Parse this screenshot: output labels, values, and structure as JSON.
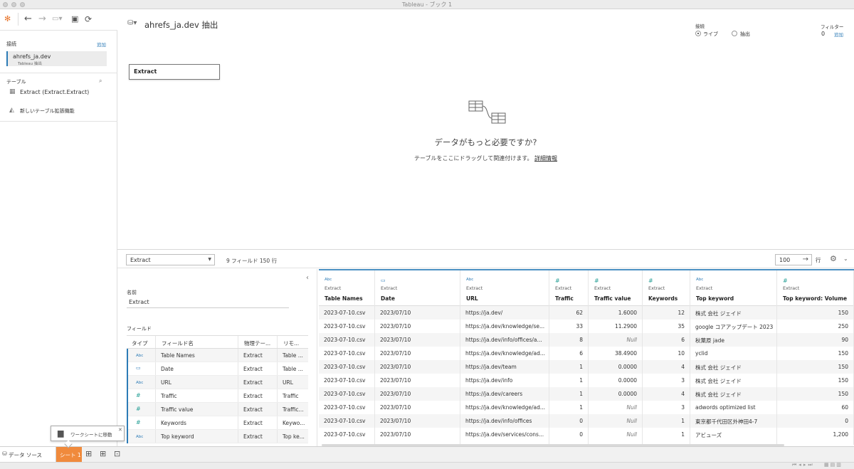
{
  "window": {
    "title": "Tableau - ブック 1"
  },
  "left_panel": {
    "connections_label": "接続",
    "add_link": "追加",
    "connection": {
      "name": "ahrefs_ja.dev",
      "type": "Tableau 抽出"
    },
    "tables_label": "テーブル",
    "table_item": "Extract (Extract.Extract)",
    "new_table_ext": "新しいテーブル拡張機能"
  },
  "canvas": {
    "datasource_title": "ahrefs_ja.dev 抽出",
    "table_box": "Extract",
    "connection_mode": {
      "label": "接続",
      "live": "ライブ",
      "extract": "抽出",
      "selected": "live"
    },
    "filters": {
      "label": "フィルター",
      "count": "0",
      "add": "追加"
    },
    "empty_title": "データがもっと必要ですか?",
    "empty_subtitle": "テーブルをここにドラッグして関連付けます。",
    "empty_link": "詳細情報"
  },
  "data_toolbar": {
    "table_select": "Extract",
    "summary": "9 フィールド 150 行",
    "rows_value": "100",
    "rows_unit": "行"
  },
  "metadata": {
    "name_label": "名前",
    "name_value": "Extract",
    "fields_label": "フィールド",
    "columns": [
      "タイプ",
      "フィールド名",
      "物理テー...",
      "リモ..."
    ],
    "rows": [
      {
        "type": "Abc",
        "name": "Table Names",
        "physical": "Extract",
        "remote": "Table ..."
      },
      {
        "type": "date",
        "name": "Date",
        "physical": "Extract",
        "remote": "Table ..."
      },
      {
        "type": "Abc",
        "name": "URL",
        "physical": "Extract",
        "remote": "URL"
      },
      {
        "type": "#",
        "name": "Traffic",
        "physical": "Extract",
        "remote": "Traffic"
      },
      {
        "type": "#",
        "name": "Traffic value",
        "physical": "Extract",
        "remote": "Traffic..."
      },
      {
        "type": "#",
        "name": "Keywords",
        "physical": "Extract",
        "remote": "Keywo..."
      },
      {
        "type": "Abc",
        "name": "Top keyword",
        "physical": "Extract",
        "remote": "Top ke..."
      }
    ]
  },
  "grid": {
    "columns": [
      {
        "type": "Abc",
        "source": "Extract",
        "name": "Table Names",
        "align": "left"
      },
      {
        "type": "date",
        "source": "Extract",
        "name": "Date",
        "align": "left"
      },
      {
        "type": "Abc",
        "source": "Extract",
        "name": "URL",
        "align": "left"
      },
      {
        "type": "#",
        "source": "Extract",
        "name": "Traffic",
        "align": "right"
      },
      {
        "type": "#",
        "source": "Extract",
        "name": "Traffic value",
        "align": "right"
      },
      {
        "type": "#",
        "source": "Extract",
        "name": "Keywords",
        "align": "right"
      },
      {
        "type": "Abc",
        "source": "Extract",
        "name": "Top keyword",
        "align": "left"
      },
      {
        "type": "#",
        "source": "Extract",
        "name": "Top keyword: Volume",
        "align": "right"
      }
    ],
    "rows": [
      [
        "2023-07-10.csv",
        "2023/07/10",
        "https://ja.dev/",
        "62",
        "1.6000",
        "12",
        "株式 会社 ジェイド",
        "150"
      ],
      [
        "2023-07-10.csv",
        "2023/07/10",
        "https://ja.dev/knowledge/se...",
        "33",
        "11.2900",
        "35",
        "google コアアップデート 2023",
        "250"
      ],
      [
        "2023-07-10.csv",
        "2023/07/10",
        "https://ja.dev/info/offices/a...",
        "8",
        "Null",
        "6",
        "秋葉原 jade",
        "90"
      ],
      [
        "2023-07-10.csv",
        "2023/07/10",
        "https://ja.dev/knowledge/ad...",
        "6",
        "38.4900",
        "10",
        "yclid",
        "150"
      ],
      [
        "2023-07-10.csv",
        "2023/07/10",
        "https://ja.dev/team",
        "1",
        "0.0000",
        "4",
        "株式 会社 ジェイド",
        "150"
      ],
      [
        "2023-07-10.csv",
        "2023/07/10",
        "https://ja.dev/info",
        "1",
        "0.0000",
        "3",
        "株式 会社 ジェイド",
        "150"
      ],
      [
        "2023-07-10.csv",
        "2023/07/10",
        "https://ja.dev/careers",
        "1",
        "0.0000",
        "4",
        "株式 会社 ジェイド",
        "150"
      ],
      [
        "2023-07-10.csv",
        "2023/07/10",
        "https://ja.dev/knowledge/ad...",
        "1",
        "Null",
        "3",
        "adwords optimized list",
        "60"
      ],
      [
        "2023-07-10.csv",
        "2023/07/10",
        "https://ja.dev/info/offices",
        "0",
        "Null",
        "1",
        "東京都千代田区外神田4-7",
        "0"
      ],
      [
        "2023-07-10.csv",
        "2023/07/10",
        "https://ja.dev/services/cons...",
        "0",
        "Null",
        "1",
        "アビューズ",
        "1,200"
      ]
    ]
  },
  "tabs": {
    "datasource": "データ ソース",
    "sheet": "シート 1"
  },
  "tooltip": {
    "text": "ワークシートに移動"
  }
}
